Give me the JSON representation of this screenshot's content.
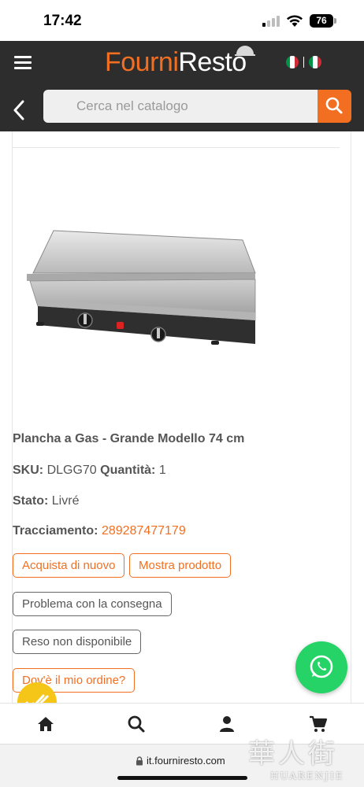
{
  "status_bar": {
    "time": "17:42",
    "battery": "76"
  },
  "header": {
    "logo_part1": "Fourni",
    "logo_part2": "Resto",
    "search_placeholder": "Cerca nel catalogo"
  },
  "product": {
    "title": "Plancha a Gas - Grande Modello 74 cm",
    "sku_label": "SKU:",
    "sku": "DLGG70",
    "qty_label": "Quantità:",
    "qty": "1",
    "status_label": "Stato:",
    "status": "Livré",
    "tracking_label": "Tracciamento:",
    "tracking": "289287477179"
  },
  "actions": {
    "buy_again": "Acquista di nuovo",
    "show_product": "Mostra prodotto",
    "delivery_problem": "Problema con la consegna",
    "return_unavailable": "Reso non disponibile",
    "where_order": "Dov'è il mio ordine?"
  },
  "bottom_nav": [
    "home-icon",
    "search-icon",
    "user-icon",
    "cart-icon"
  ],
  "browser": {
    "url": "it.fourniresto.com"
  },
  "watermark": {
    "line1": "華人街",
    "line2": "HUARENJIE"
  },
  "colors": {
    "accent": "#f26f21",
    "header_bg": "#2d2d2d",
    "whatsapp": "#25d366",
    "badge": "#f5c518"
  }
}
